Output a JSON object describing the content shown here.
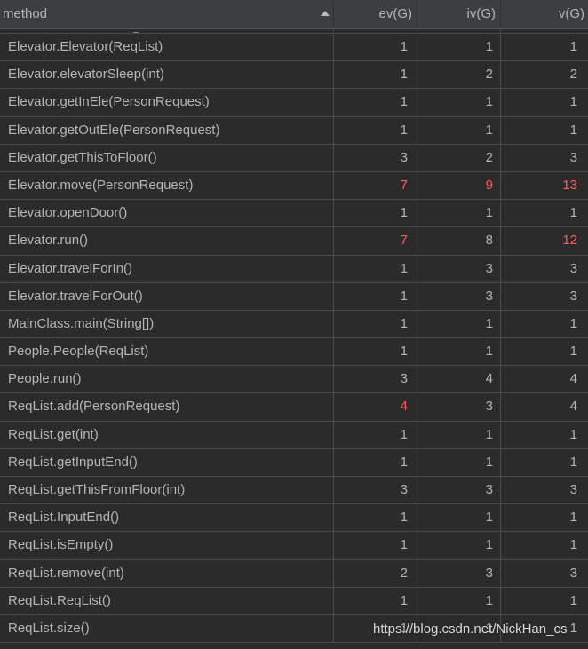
{
  "table": {
    "columns": [
      "method",
      "ev(G)",
      "iv(G)",
      "v(G)"
    ],
    "rows": [
      {
        "method": "Elevator.Elevator(ReqList)",
        "ev": "1",
        "iv": "1",
        "v": "1"
      },
      {
        "method": "Elevator.elevatorSleep(int)",
        "ev": "1",
        "iv": "2",
        "v": "2"
      },
      {
        "method": "Elevator.getInEle(PersonRequest)",
        "ev": "1",
        "iv": "1",
        "v": "1"
      },
      {
        "method": "Elevator.getOutEle(PersonRequest)",
        "ev": "1",
        "iv": "1",
        "v": "1"
      },
      {
        "method": "Elevator.getThisToFloor()",
        "ev": "3",
        "iv": "2",
        "v": "3"
      },
      {
        "method": "Elevator.move(PersonRequest)",
        "ev": "7",
        "iv": "9",
        "v": "13"
      },
      {
        "method": "Elevator.openDoor()",
        "ev": "1",
        "iv": "1",
        "v": "1"
      },
      {
        "method": "Elevator.run()",
        "ev": "7",
        "iv": "8",
        "v": "12"
      },
      {
        "method": "Elevator.travelForIn()",
        "ev": "1",
        "iv": "3",
        "v": "3"
      },
      {
        "method": "Elevator.travelForOut()",
        "ev": "1",
        "iv": "3",
        "v": "3"
      },
      {
        "method": "MainClass.main(String[])",
        "ev": "1",
        "iv": "1",
        "v": "1"
      },
      {
        "method": "People.People(ReqList)",
        "ev": "1",
        "iv": "1",
        "v": "1"
      },
      {
        "method": "People.run()",
        "ev": "3",
        "iv": "4",
        "v": "4"
      },
      {
        "method": "ReqList.add(PersonRequest)",
        "ev": "4",
        "iv": "3",
        "v": "4"
      },
      {
        "method": "ReqList.get(int)",
        "ev": "1",
        "iv": "1",
        "v": "1"
      },
      {
        "method": "ReqList.getInputEnd()",
        "ev": "1",
        "iv": "1",
        "v": "1"
      },
      {
        "method": "ReqList.getThisFromFloor(int)",
        "ev": "3",
        "iv": "3",
        "v": "3"
      },
      {
        "method": "ReqList.InputEnd()",
        "ev": "1",
        "iv": "1",
        "v": "1"
      },
      {
        "method": "ReqList.isEmpty()",
        "ev": "1",
        "iv": "1",
        "v": "1"
      },
      {
        "method": "ReqList.remove(int)",
        "ev": "2",
        "iv": "3",
        "v": "3"
      },
      {
        "method": "ReqList.ReqList()",
        "ev": "1",
        "iv": "1",
        "v": "1"
      },
      {
        "method": "ReqList.size()",
        "ev": "1",
        "iv": "1",
        "v": "1"
      }
    ],
    "highlighted": {
      "5": [
        "ev",
        "iv",
        "v"
      ],
      "7": [
        "ev",
        "v"
      ],
      "13": [
        "ev"
      ]
    },
    "sort": {
      "column": "method",
      "direction": "ascending",
      "icon": "sort-ascending-icon"
    }
  },
  "colors": {
    "background": "#2b2b2b",
    "header_background": "#3c3f41",
    "text": "#b5b5b5",
    "highlight": "#ff5a5a",
    "grid": "#4a4a4a"
  },
  "watermark": "https://blog.csdn.net/NickHan_cs"
}
